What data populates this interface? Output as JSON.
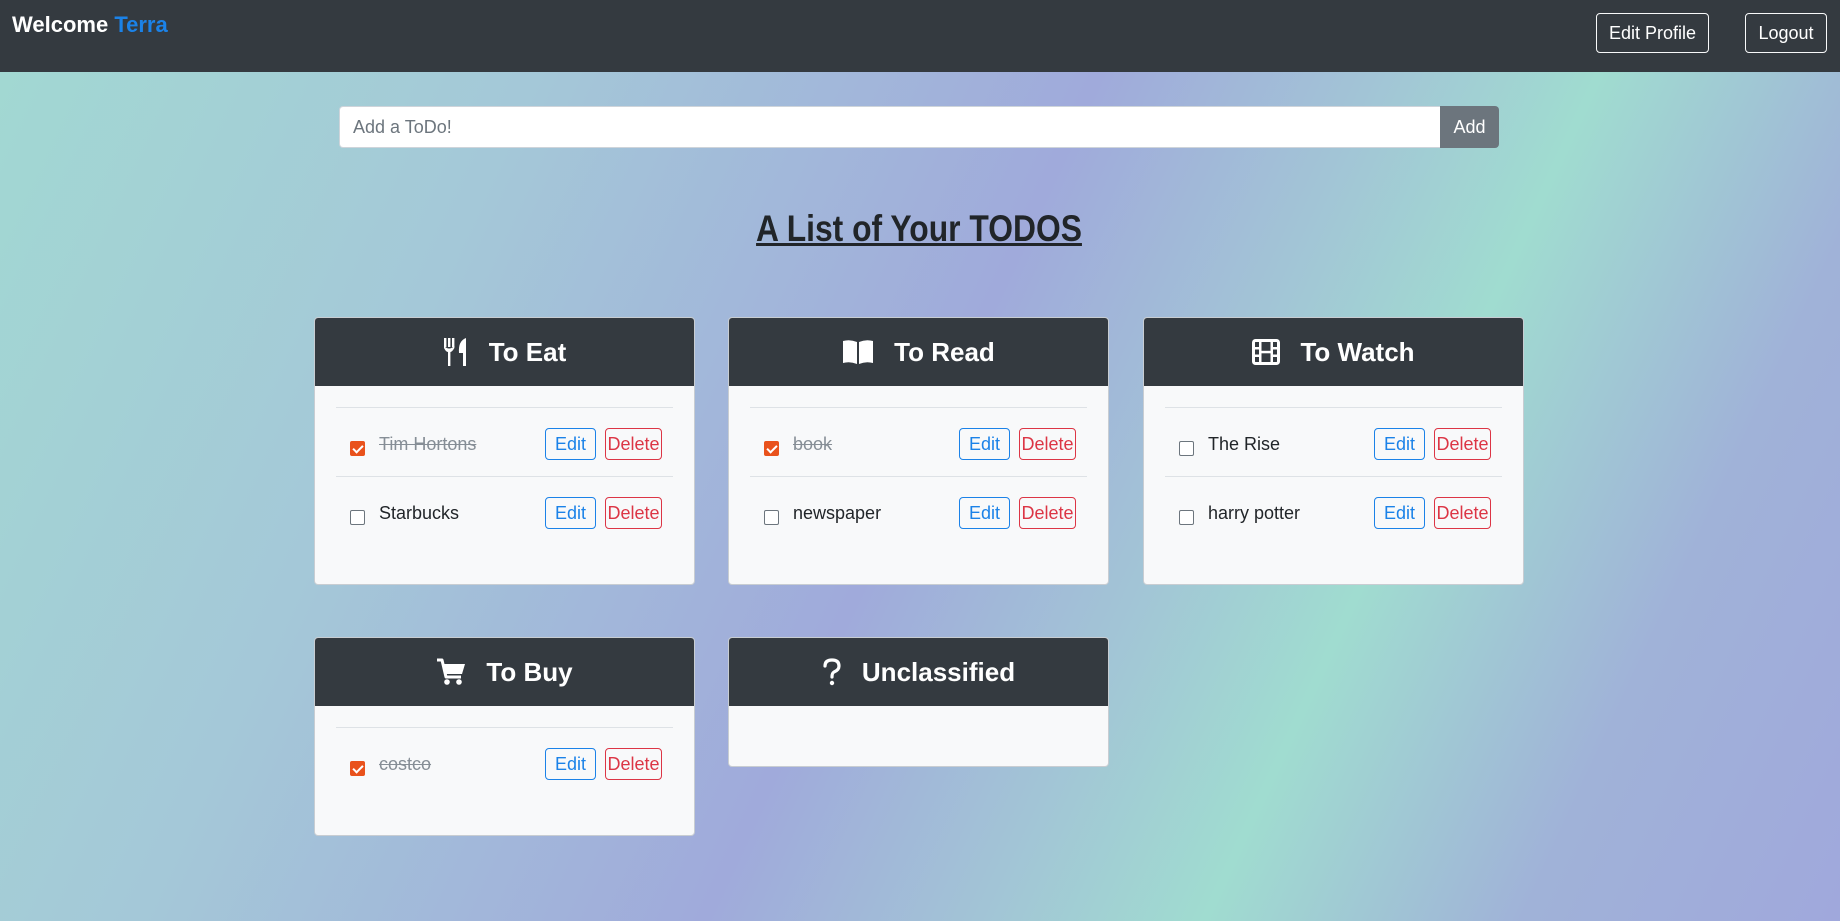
{
  "navbar": {
    "welcome": "Welcome",
    "user": "Terra",
    "edit_profile": "Edit Profile",
    "logout": "Logout"
  },
  "add_form": {
    "placeholder": "Add a ToDo!",
    "button": "Add"
  },
  "page_title": "A List of Your TODOS",
  "colors": {
    "navbar": "#343a40",
    "brand_user": "#1b82e8",
    "edit": "#1b82e8",
    "delete": "#dc3545",
    "checked": "#e9521c",
    "add_button": "#6c757d"
  },
  "categories": [
    {
      "title": "To Eat",
      "icon": "utensils-icon",
      "items": [
        {
          "label": "Tim Hortons",
          "done": true,
          "edit": "Edit",
          "delete": "Delete"
        },
        {
          "label": "Starbucks",
          "done": false,
          "edit": "Edit",
          "delete": "Delete"
        }
      ]
    },
    {
      "title": "To Read",
      "icon": "book-open-icon",
      "items": [
        {
          "label": "book",
          "done": true,
          "edit": "Edit",
          "delete": "Delete"
        },
        {
          "label": "newspaper",
          "done": false,
          "edit": "Edit",
          "delete": "Delete"
        }
      ]
    },
    {
      "title": "To Watch",
      "icon": "film-icon",
      "items": [
        {
          "label": "The Rise",
          "done": false,
          "edit": "Edit",
          "delete": "Delete"
        },
        {
          "label": "harry potter",
          "done": false,
          "edit": "Edit",
          "delete": "Delete"
        }
      ]
    },
    {
      "title": "To Buy",
      "icon": "shopping-cart-icon",
      "items": [
        {
          "label": "costco",
          "done": true,
          "edit": "Edit",
          "delete": "Delete"
        }
      ]
    },
    {
      "title": "Unclassified",
      "icon": "question-icon",
      "items": []
    }
  ]
}
